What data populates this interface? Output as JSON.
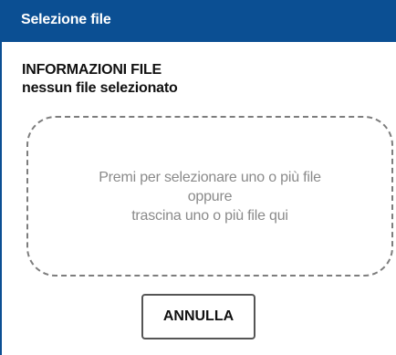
{
  "dialog": {
    "title": "Selezione file",
    "info_heading": "INFORMAZIONI FILE",
    "info_status": "nessun file selezionato",
    "dropzone": {
      "line1": "Premi per selezionare uno o più file",
      "line2": "oppure",
      "line3": "trascina uno o più file qui"
    },
    "cancel_label": "ANNULLA"
  },
  "colors": {
    "titlebar_background": "#0b4f93",
    "dropzone_border": "#7d7d7d",
    "dropzone_text": "#8a8a8a"
  }
}
